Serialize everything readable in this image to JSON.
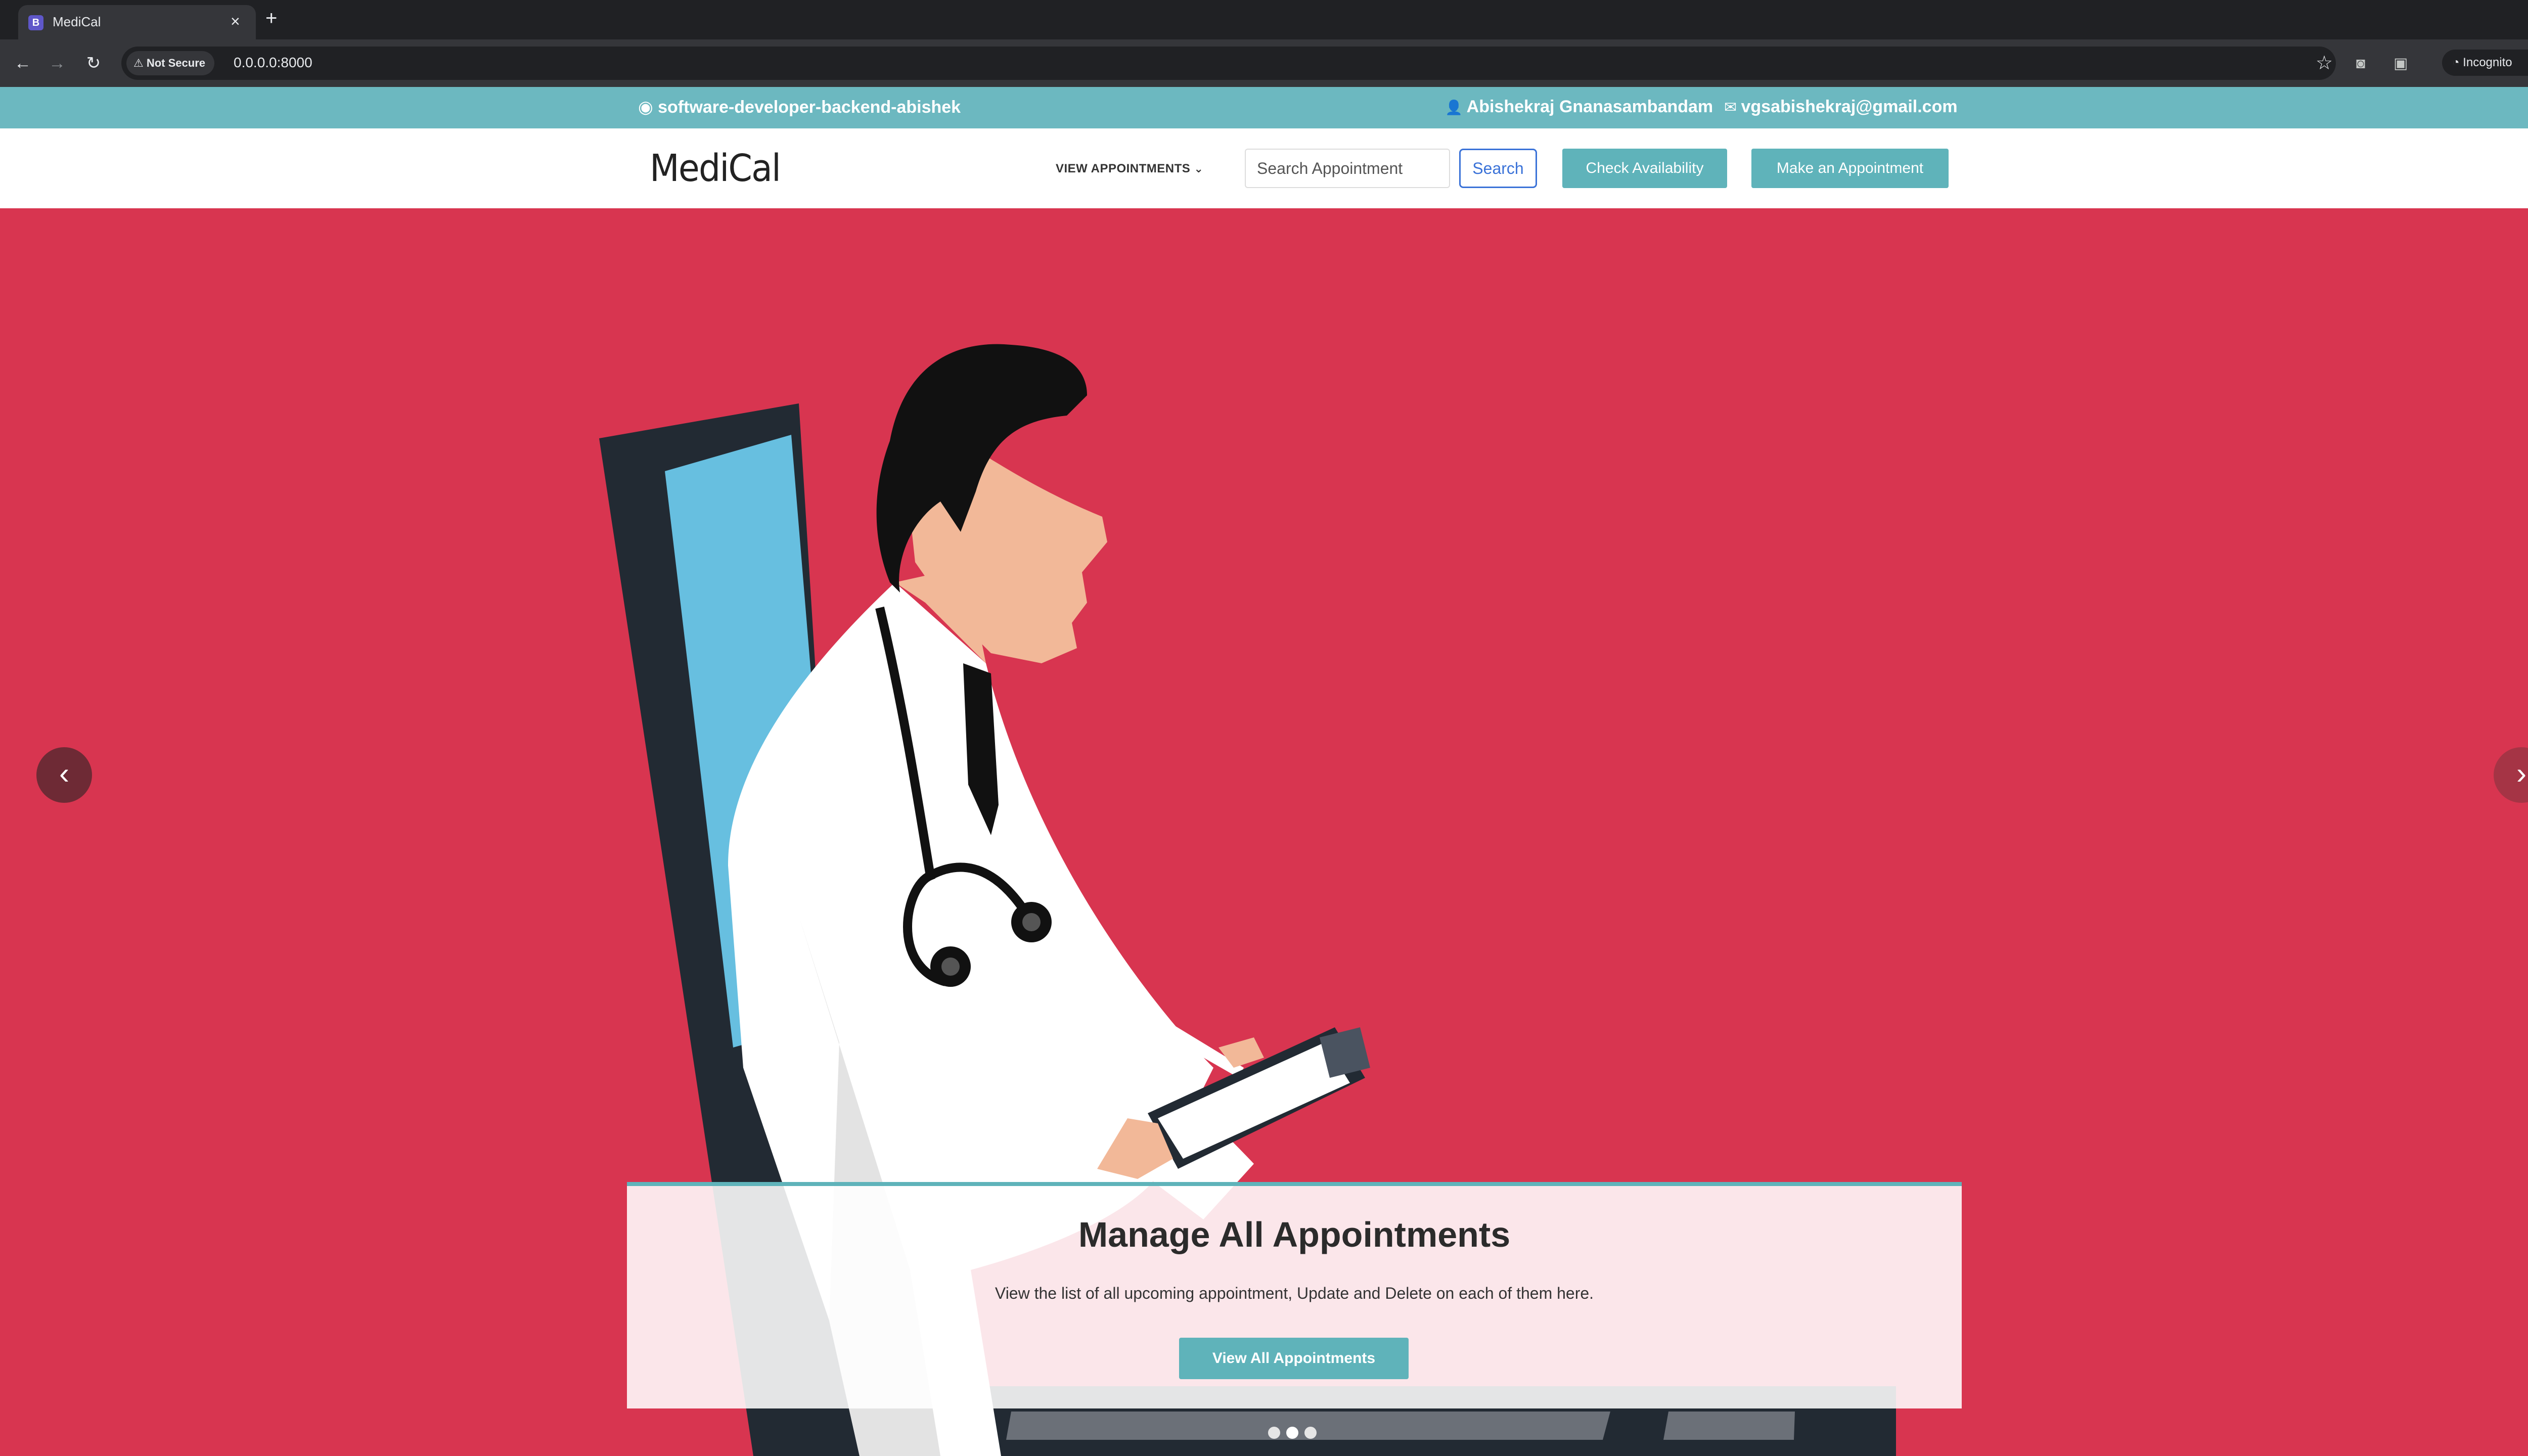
{
  "browser": {
    "tab_title": "MediCal",
    "tab_favicon": "B",
    "tab_close": "×",
    "new_tab": "+",
    "security_label": "Not Secure",
    "url": "0.0.0.0:8000",
    "incognito_label": "Incognito"
  },
  "topbar": {
    "github": "software-developer-backend-abishek",
    "user_name": "Abishekraj Gnanasambandam",
    "user_email": "vgsabishekraj@gmail.com"
  },
  "navbar": {
    "logo": "MediCal",
    "view_appointments": "VIEW APPOINTMENTS",
    "search_placeholder": "Search Appointment",
    "search_label": "Search",
    "check_availability": "Check Availability",
    "make_appointment": "Make an Appointment"
  },
  "hero": {
    "caption_title": "Manage All Appointments",
    "caption_text": "View the list of all upcoming appointment, Update and Delete on each of them here.",
    "caption_button": "View All Appointments",
    "slide_count": 3,
    "active_slide": 2
  },
  "colors": {
    "accent_teal": "#5fb3ba",
    "hero_background": "#d83550",
    "search_blue": "#3a72d8"
  }
}
